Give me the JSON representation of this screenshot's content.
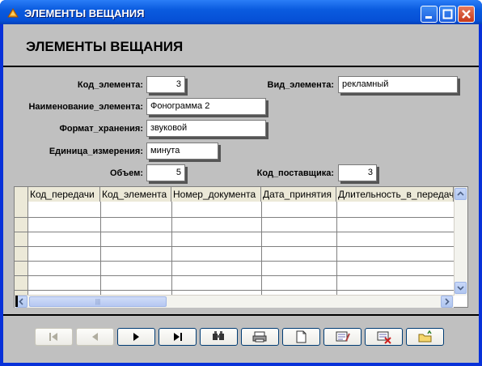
{
  "window": {
    "title": "ЭЛЕМЕНТЫ ВЕЩАНИЯ"
  },
  "form": {
    "heading": "ЭЛЕМЕНТЫ ВЕЩАНИЯ",
    "fields": {
      "kod_elementa": {
        "label": "Код_элемента:",
        "value": "3"
      },
      "vid_elementa": {
        "label": "Вид_элемента:",
        "value": "рекламный"
      },
      "naimenovanie": {
        "label": "Наименование_элемента:",
        "value": "Фонограмма 2"
      },
      "format": {
        "label": "Формат_хранения:",
        "value": "звуковой"
      },
      "edinica": {
        "label": "Единица_измерения:",
        "value": "минута"
      },
      "obem": {
        "label": "Объем:",
        "value": "5"
      },
      "kod_postavshika": {
        "label": "Код_поставщика:",
        "value": "3"
      }
    }
  },
  "subform": {
    "columns": [
      "Код_передачи",
      "Код_элемента",
      "Номер_документа",
      "Дата_принятия",
      "Длительность_в_передаче"
    ],
    "rows": [],
    "scroll_thumb_glyph": "|||"
  },
  "nav": {
    "first": "|◀",
    "prev": "◀",
    "next": "▶",
    "last": "▶|",
    "find_icon": "find-icon",
    "print_icon": "print-icon",
    "new_icon": "new-record-icon",
    "edit_icon": "edit-icon",
    "delete_icon": "delete-icon",
    "open_icon": "open-folder-icon"
  },
  "colors": {
    "titlebar": "#0a5bdf",
    "form_bg": "#c0c0c0",
    "accent": "#0831d9"
  }
}
